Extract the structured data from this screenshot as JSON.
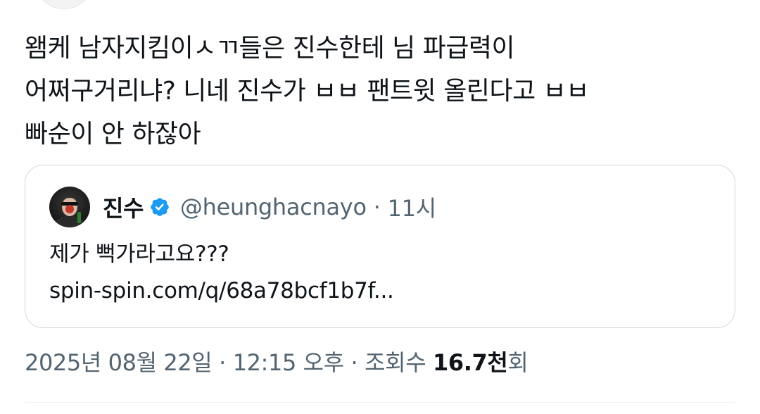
{
  "tweet": {
    "lines": [
      "왬케 남자지킴이ㅅㄲ들은 진수한테 님 파급력이",
      "어쩌구거리냐? 니네 진수가 ㅂㅂ 팬트윗 올린다고 ㅂㅂ",
      "빠순이 안 하잖아"
    ]
  },
  "quote": {
    "name": "진수",
    "handle": "@heunghacnayo",
    "separator": "·",
    "time": "11시",
    "body_lines": [
      "제가 뻑가라고요???",
      "spin-spin.com/q/68a78bcf1b7f..."
    ],
    "verified_color": "#1d9bf0"
  },
  "meta": {
    "date": "2025년 08월 22일",
    "sep1": "·",
    "time": "12:15 오후",
    "sep2": "·",
    "views_label": "조회수",
    "views_count": "16.7천",
    "views_suffix": "회"
  }
}
